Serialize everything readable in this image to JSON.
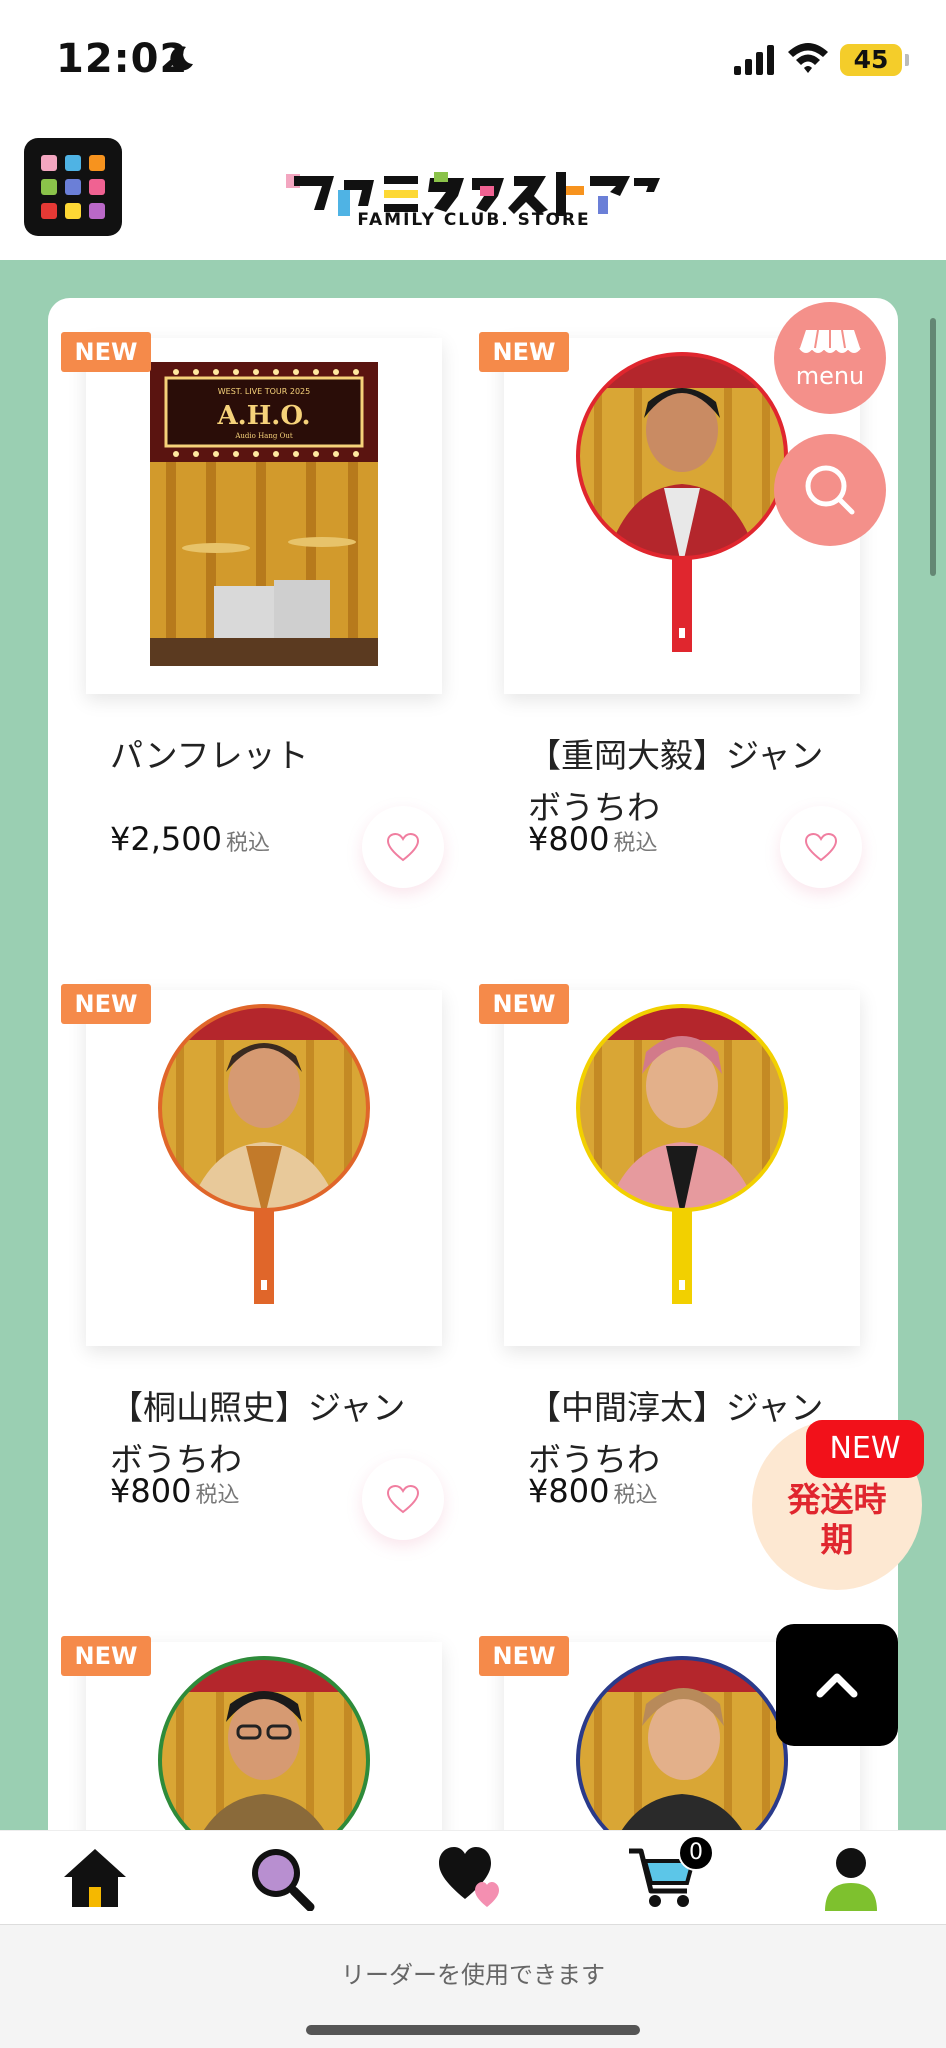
{
  "status_bar": {
    "time": "12:02",
    "battery": "45"
  },
  "header": {
    "logo_text": "ファミクラストア",
    "logo_subtitle": "FAMILY CLUB. STORE"
  },
  "products": [
    {
      "badge": "NEW",
      "title": "パンフレット",
      "price": "¥2,500",
      "tax": "税込",
      "image": "pamphlet-cover"
    },
    {
      "badge": "NEW",
      "title": "【重岡大毅】ジャンボうちわ",
      "price": "¥800",
      "tax": "税込",
      "image": "uchiwa-red"
    },
    {
      "badge": "NEW",
      "title": "【桐山照史】ジャンボうちわ",
      "price": "¥800",
      "tax": "税込",
      "image": "uchiwa-orange"
    },
    {
      "badge": "NEW",
      "title": "【中間淳太】ジャンボうちわ",
      "price": "¥800",
      "tax": "税込",
      "image": "uchiwa-yellow"
    },
    {
      "badge": "NEW",
      "image": "uchiwa-green"
    },
    {
      "badge": "NEW",
      "image": "uchiwa-blue"
    }
  ],
  "pamphlet": {
    "tour": "WEST. LIVE TOUR 2025",
    "sign": "A.H.O.",
    "sign_sub": "Audio Hang Out"
  },
  "floating": {
    "menu_label": "menu",
    "shipping_badge": "NEW",
    "shipping_text": "発送時期"
  },
  "bottom_nav": {
    "cart_count": "0"
  },
  "footer": {
    "reader_text": "リーダーを使用できます"
  },
  "colors": {
    "green_bg": "#9acfb2",
    "new_badge": "#f58a4a",
    "float_pink": "#f4908a",
    "shipping_red": "#f2111a"
  }
}
